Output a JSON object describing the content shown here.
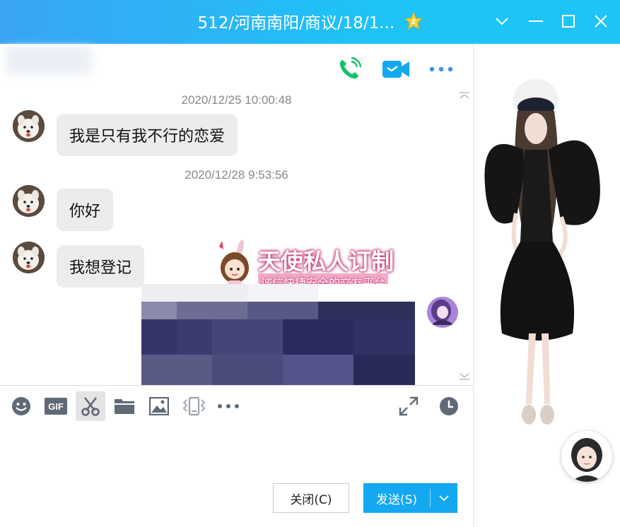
{
  "window": {
    "title": "512/河南南阳/商议/18/1...",
    "accent": "#1ec3f7",
    "send_color": "#13a8f0"
  },
  "header": {
    "icons": [
      "phone-call-icon",
      "video-call-icon",
      "more-icon"
    ]
  },
  "messages": [
    {
      "timestamp": "2020/12/25 10:00:48",
      "text": "我是只有我不行的恋爱"
    },
    {
      "timestamp": "2020/12/28 9:53:56",
      "text": "你好"
    },
    {
      "timestamp": "",
      "text": "我想登记"
    }
  ],
  "promo": {
    "title": "天使私人订制",
    "subtitle": "诚信快捷安全的交友平台"
  },
  "toolbar": {
    "tools": [
      "emoji-icon",
      "gif-icon",
      "scissors-icon",
      "folder-icon",
      "image-icon",
      "shake-icon",
      "more-icon",
      "expand-icon",
      "history-icon"
    ]
  },
  "actions": {
    "close_label": "关闭(C)",
    "send_label": "发送(S)"
  }
}
